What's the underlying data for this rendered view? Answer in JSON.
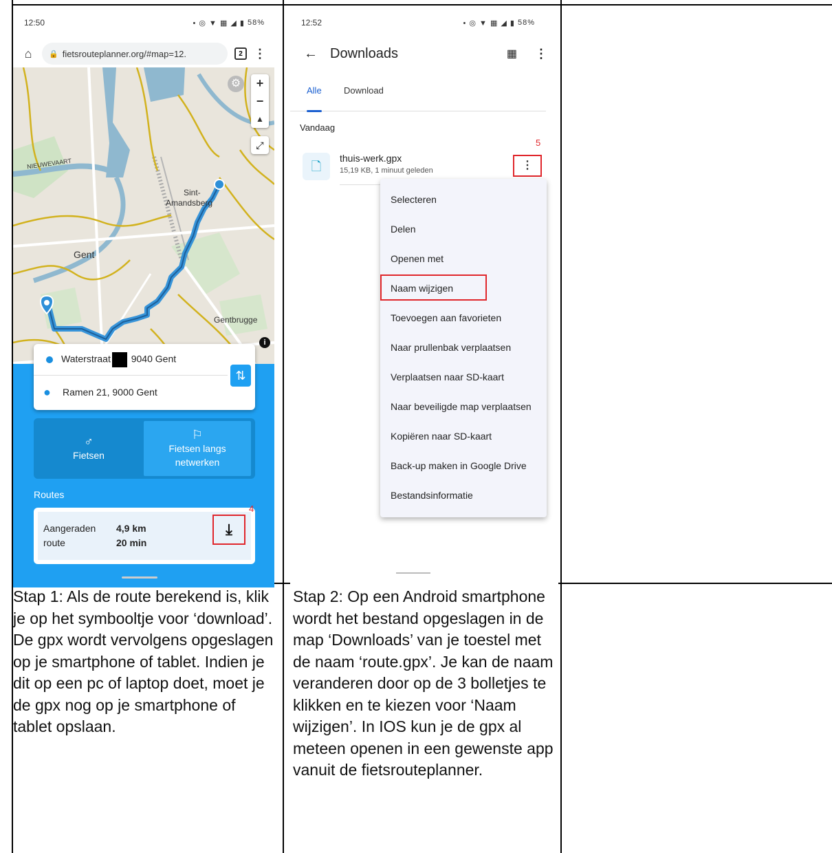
{
  "phone1": {
    "status": {
      "time": "12:50",
      "battery": "58%"
    },
    "browser": {
      "url": "fietsrouteplanner.org/#map=12.",
      "tab_count": "2"
    },
    "map": {
      "labels": {
        "street": "NIEUWEVAART",
        "district1": "Sint-",
        "district2": "Amandsberg",
        "city": "Gent",
        "district3": "Gentbrugge"
      }
    },
    "from": {
      "street": "Waterstraat",
      "rest": "9040 Gent"
    },
    "to": {
      "address": "Ramen 21, 9000 Gent"
    },
    "modes": [
      {
        "label": "Fietsen"
      },
      {
        "label1": "Fietsen langs",
        "label2": "netwerken"
      }
    ],
    "routes_label": "Routes",
    "route": {
      "name1": "Aangeraden",
      "name2": "route",
      "distance": "4,9 km",
      "duration": "20 min"
    },
    "annotation": "4"
  },
  "phone2": {
    "status": {
      "time": "12:52",
      "battery": "58%"
    },
    "title": "Downloads",
    "tabs": [
      "Alle",
      "Download"
    ],
    "section": "Vandaag",
    "file": {
      "name": "thuis-werk.gpx",
      "meta": "15,19 KB, 1 minuut geleden"
    },
    "annotation": "5",
    "menu": [
      "Selecteren",
      "Delen",
      "Openen met",
      "Naam wijzigen",
      "Toevoegen aan favorieten",
      "Naar prullenbak verplaatsen",
      "Verplaatsen naar SD-kaart",
      "Naar beveiligde map verplaatsen",
      "Kopiëren naar SD-kaart",
      "Back-up maken in Google Drive",
      "Bestandsinformatie"
    ]
  },
  "captions": {
    "step1": "Stap 1: Als de route berekend is, klik je op het symbooltje voor ‘download’. De gpx wordt vervolgens opgeslagen op je smartphone of tablet. Indien je dit op een pc of laptop doet, moet je de gpx nog op je smartphone of tablet opslaan.",
    "step2": "Stap 2: Op een Android smartphone wordt het bestand opgeslagen in de map ‘Downloads’ van je toestel met de naam ‘route.gpx’. Je kan de naam veranderen door op de 3 bolletjes te klikken en te kiezen voor ‘Naam wijzigen’. In IOS kun je de gpx al meteen openen in een gewenste app vanuit de fietsrouteplanner."
  },
  "colors": {
    "accent": "#1fa0f2",
    "highlight": "#e0262b",
    "route": "#2d8fd8"
  }
}
